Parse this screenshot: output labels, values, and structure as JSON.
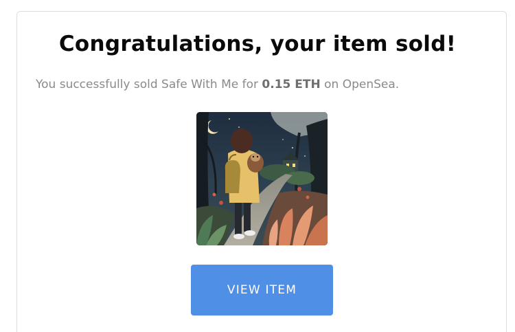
{
  "message": {
    "title": "Congratulations, your item sold!",
    "text_before": "You successfully sold Safe With Me for ",
    "price": "0.15 ETH",
    "text_after": " on OpenSea."
  },
  "item": {
    "image_icon": "nft-artwork-image"
  },
  "actions": {
    "view_item_label": "VIEW ITEM"
  },
  "colors": {
    "button_background": "#4f8fe6",
    "title_text": "#0a0a0a",
    "body_text": "#8a8a8a"
  }
}
